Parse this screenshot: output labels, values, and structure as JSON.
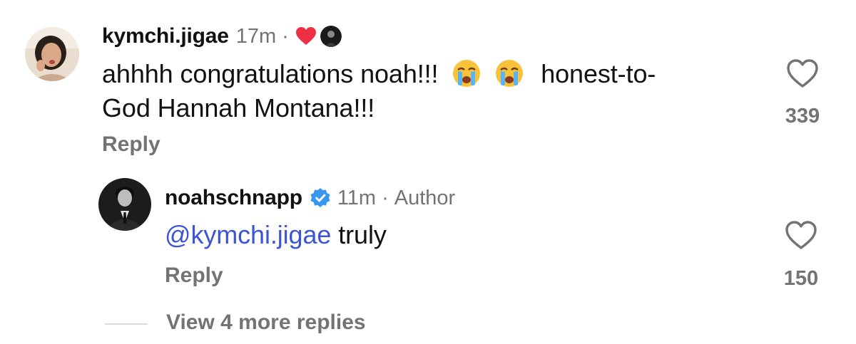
{
  "comment": {
    "username": "kymchi.jigae",
    "time": "17m",
    "separator": "·",
    "text_part1": "ahhhh congratulations noah!!!",
    "emoji_1": "loudly-crying-face-emoji",
    "emoji_2": "loudly-crying-face-emoji",
    "text_part2": "honest-to-",
    "text_line2": "God Hannah Montana!!!",
    "reply_label": "Reply",
    "like_count": "339",
    "liked_by_author_icon": "red-heart-icon"
  },
  "reply": {
    "username": "noahschnapp",
    "verified_icon": "verified-badge-icon",
    "time": "11m",
    "separator": "·",
    "author_label": "Author",
    "mention": "@kymchi.jigae",
    "text": "truly",
    "reply_label": "Reply",
    "like_count": "150"
  },
  "view_more": {
    "label": "View 4 more replies"
  },
  "colors": {
    "mention": "#3c55d6",
    "secondary_text": "#737373",
    "heart_red": "#ed2f46",
    "verified_blue": "#3897f0"
  }
}
